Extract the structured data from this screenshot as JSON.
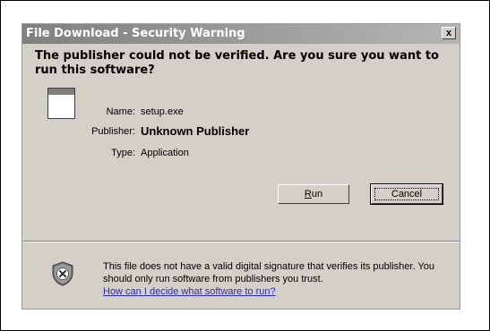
{
  "dialog": {
    "title": "File Download - Security Warning",
    "close_label": "x",
    "question": "The publisher could not be verified.  Are you sure you want to run this software?",
    "info": [
      {
        "label": "Name:",
        "value": "setup.exe"
      },
      {
        "label": "Publisher:",
        "value": "Unknown Publisher"
      },
      {
        "label": "Type:",
        "value": "Application"
      }
    ],
    "buttons": {
      "run_label_key": "R",
      "run_label_rest": "un",
      "cancel_label": "Cancel"
    },
    "warning_text": "This file does not have a valid digital signature that verifies its publisher.  You should only run software from publishers you trust.",
    "help_link": "How can I decide what software to run?"
  },
  "icons": {
    "file": "application-window-icon",
    "shield": "security-shield-icon"
  }
}
